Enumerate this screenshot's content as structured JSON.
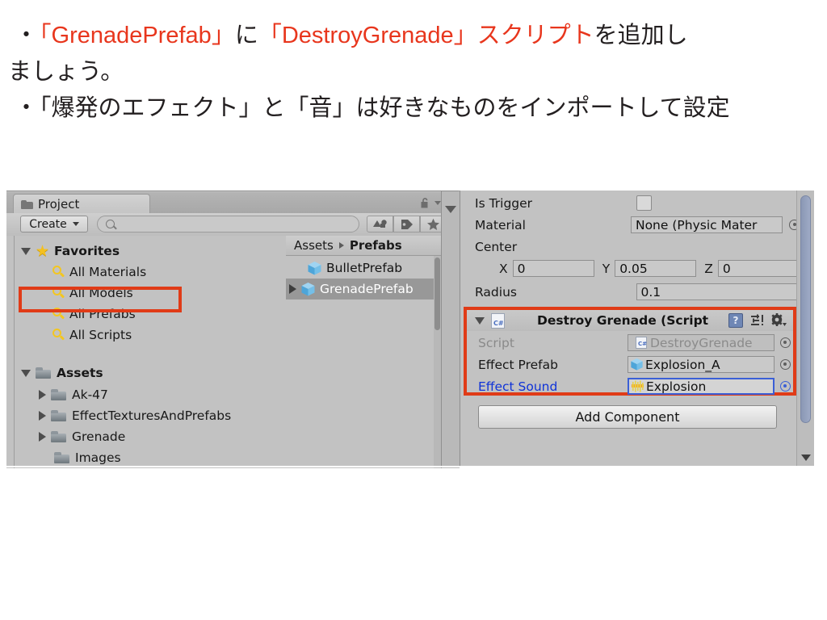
{
  "slide": {
    "line1_bullet": "・",
    "line1_a": "「GrenadePrefab」",
    "line1_b": "に",
    "line1_c": "「DestroyGrenade」スクリプト",
    "line1_d": "を追加し",
    "line2": "ましょう。",
    "line3_bullet": "・",
    "line3": "「爆発のエフェクト」と「音」は好きなものをインポートして設定",
    "accent_color": "#e8361d",
    "text_color": "#231f20"
  },
  "project_panel": {
    "tab_label": "Project",
    "tab_icon": "folder-icon",
    "lock_icon": "lock-open-icon",
    "menu_icon": "panel-menu-icon",
    "create_button": "Create",
    "search_placeholder": "",
    "search_value": "",
    "search_icon": "search-icon",
    "filters": [
      {
        "name": "filter-by-type-button",
        "icon": "shapes-icon"
      },
      {
        "name": "filter-by-label-button",
        "icon": "tag-icon"
      },
      {
        "name": "filter-favorites-button",
        "icon": "star-icon"
      }
    ],
    "tree": [
      {
        "label": "Favorites",
        "icon": "star-icon",
        "depth": 0,
        "expanded": true,
        "bold": true
      },
      {
        "label": "All Materials",
        "icon": "search-icon",
        "depth": 1,
        "expanded": null,
        "bold": false
      },
      {
        "label": "All Models",
        "icon": "search-icon",
        "depth": 1,
        "expanded": null,
        "bold": false
      },
      {
        "label": "All Prefabs",
        "icon": "search-icon",
        "depth": 1,
        "expanded": null,
        "bold": false
      },
      {
        "label": "All Scripts",
        "icon": "search-icon",
        "depth": 1,
        "expanded": null,
        "bold": false
      },
      {
        "label": "Assets",
        "icon": "folder-icon",
        "depth": 0,
        "expanded": true,
        "bold": true
      },
      {
        "label": "Ak-47",
        "icon": "folder-icon",
        "depth": 1,
        "expanded": false,
        "bold": false
      },
      {
        "label": "EffectTexturesAndPrefabs",
        "icon": "folder-icon",
        "depth": 1,
        "expanded": false,
        "bold": false
      },
      {
        "label": "Grenade",
        "icon": "folder-icon",
        "depth": 1,
        "expanded": false,
        "bold": false
      },
      {
        "label": "Images",
        "icon": "folder-icon",
        "depth": 1,
        "expanded": false,
        "bold": false
      }
    ],
    "breadcrumb": {
      "root": "Assets",
      "current": "Prefabs"
    },
    "assets": [
      {
        "label": "BulletPrefab",
        "icon": "prefab-cube-icon",
        "selected": false,
        "expandable": false
      },
      {
        "label": "GrenadePrefab",
        "icon": "prefab-cube-icon",
        "selected": true,
        "expandable": true
      }
    ]
  },
  "inspector": {
    "rows": [
      {
        "label": "Is Trigger",
        "type": "checkbox",
        "value": false
      },
      {
        "label": "Material",
        "type": "object",
        "value": "None (Physic Mater"
      },
      {
        "label": "Center",
        "type": "header"
      }
    ],
    "center": {
      "label": "Center",
      "x_label": "X",
      "x": "0",
      "y_label": "Y",
      "y": "0.05",
      "z_label": "Z",
      "z": "0"
    },
    "radius": {
      "label": "Radius",
      "value": "0.1"
    },
    "component": {
      "title": "Destroy Grenade (Script",
      "icon": "csharp-script-icon",
      "expanded": true,
      "help_icon": "help-icon",
      "preset_icon": "preset-icon",
      "gear_icon": "gear-icon",
      "fields": [
        {
          "label": "Script",
          "value": "DestroyGrenade",
          "icon": "csharp-script-icon",
          "dim": true,
          "focused": false,
          "label_color": "#8a8a8a"
        },
        {
          "label": "Effect Prefab",
          "value": "Explosion_A",
          "icon": "prefab-cube-icon",
          "dim": false,
          "focused": false,
          "label_color": "#171717"
        },
        {
          "label": "Effect Sound",
          "value": "Explosion",
          "icon": "audio-clip-icon",
          "dim": false,
          "focused": true,
          "label_color": "#1033d8"
        }
      ]
    },
    "add_component_button": "Add Component",
    "highlight_color": "#e03b17"
  }
}
